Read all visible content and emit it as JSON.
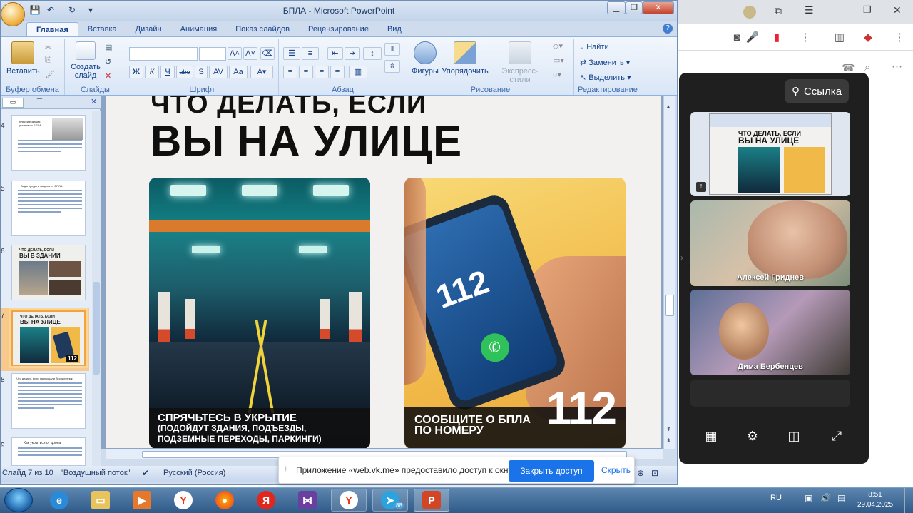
{
  "ppt": {
    "title": "БПЛА - Microsoft PowerPoint",
    "tabs": [
      "Главная",
      "Вставка",
      "Дизайн",
      "Анимация",
      "Показ слайдов",
      "Рецензирование",
      "Вид"
    ],
    "groups": {
      "clipboard": "Буфер обмена",
      "slides": "Слайды",
      "font": "Шрифт",
      "paragraph": "Абзац",
      "drawing": "Рисование",
      "editing": "Редактирование"
    },
    "buttons": {
      "paste": "Вставить",
      "new_slide_1": "Создать",
      "new_slide_2": "слайд",
      "shapes": "Фигуры",
      "arrange": "Упорядочить",
      "quick_styles": "Экспресс-стили",
      "find": "Найти",
      "replace": "Заменить",
      "select": "Выделить"
    },
    "format_buttons": [
      "Ж",
      "К",
      "Ч",
      "abe",
      "S"
    ],
    "thumbs": [
      {
        "num": "4",
        "title": "Классификация дронов по БПЛА"
      },
      {
        "num": "5",
        "title": "Виды средств защиты от БПЛА:"
      },
      {
        "num": "6",
        "title_line1": "ЧТО ДЕЛАТЬ, ЕСЛИ",
        "title_line2": "ВЫ В ЗДАНИИ"
      },
      {
        "num": "7",
        "title_line1": "ЧТО ДЕЛАТЬ, ЕСЛИ",
        "title_line2": "ВЫ НА УЛИЦЕ",
        "badge": "112"
      },
      {
        "num": "8",
        "title": "Что делать, если заслышали беспилотник"
      },
      {
        "num": "9",
        "title": "Как укрыться от дрона"
      }
    ],
    "slide": {
      "title_line1": "ЧТО ДЕЛАТЬ, ЕСЛИ",
      "title_line2": "ВЫ НА УЛИЦЕ",
      "card1_caption_line1": "СПРЯЧЬТЕСЬ В УКРЫТИЕ",
      "card1_caption_line2": "(ПОДОЙДУТ ЗДАНИЯ, ПОДЪЕЗДЫ,",
      "card1_caption_line3": "ПОДЗЕМНЫЕ ПЕРЕХОДЫ, ПАРКИНГИ)",
      "card2_caption_line1": "СООБЩИТЕ О БПЛА",
      "card2_caption_line2": "ПО НОМЕРУ",
      "card2_number": "112",
      "phone_number": "112"
    },
    "status": {
      "slide": "Слайд 7 из 10",
      "theme": "\"Воздушный поток\"",
      "language": "Русский (Россия)"
    }
  },
  "share_bar": {
    "text": "Приложение «web.vk.me» предоставило доступ к окну.",
    "stop": "Закрыть доступ",
    "hide": "Скрыть"
  },
  "vk": {
    "link_button": "Ссылка",
    "participants": [
      "Алексей Гриднев",
      "Дима Бербенцев"
    ],
    "preview_title_line1": "ЧТО ДЕЛАТЬ, ЕСЛИ",
    "preview_title_line2": "ВЫ НА УЛИЦЕ"
  },
  "taskbar": {
    "lang": "RU",
    "time": "8:51",
    "date": "29.04.2025",
    "badge": "88"
  },
  "colors": {
    "ppt_blue": "#15428b",
    "share_blue": "#1a73e8",
    "phone_green": "#2fc25b"
  }
}
